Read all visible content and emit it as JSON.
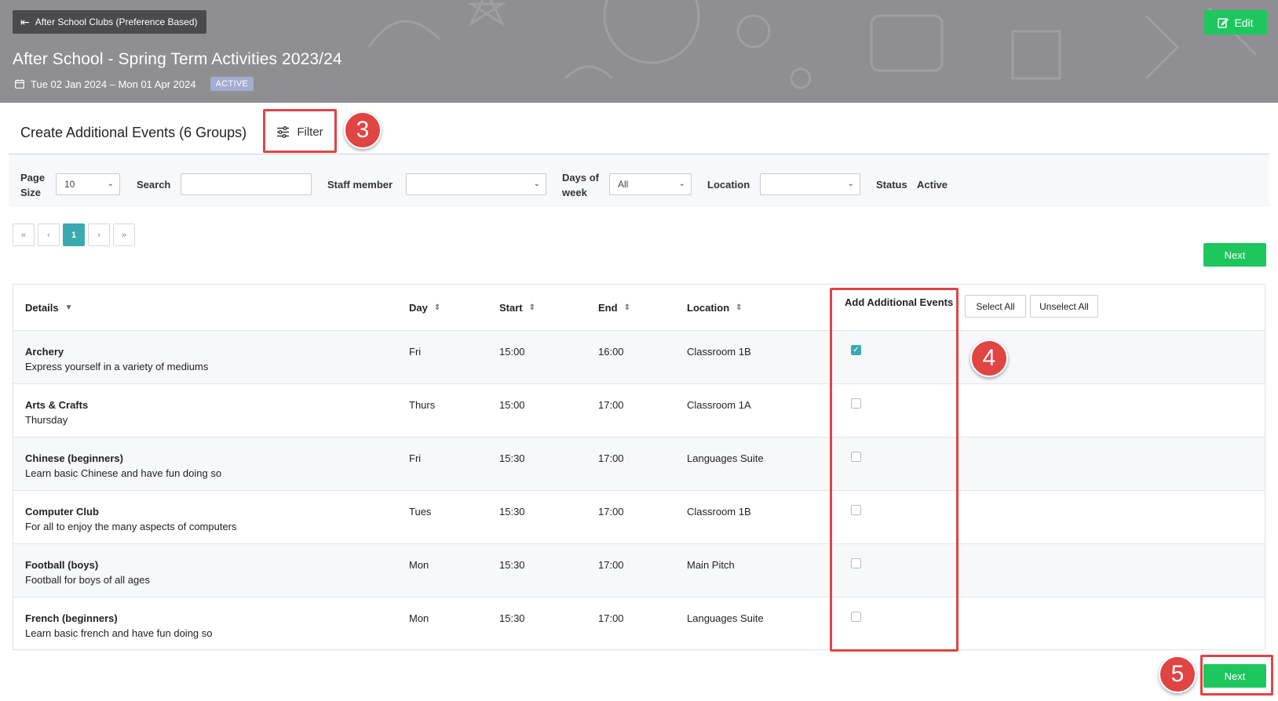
{
  "header": {
    "back_label": "After School Clubs (Preference Based)",
    "edit_label": "Edit",
    "title": "After School - Spring Term Activities 2023/24",
    "date_range": "Tue 02 Jan 2024 – Mon 01 Apr 2024",
    "status": "ACTIVE"
  },
  "section": {
    "title": "Create Additional Events (6 Groups)",
    "filter_label": "Filter"
  },
  "filters": {
    "page_size_label_1": "Page",
    "page_size_label_2": "Size",
    "page_size_value": "10",
    "search_label": "Search",
    "search_value": "",
    "staff_label": "Staff member",
    "staff_value": "",
    "days_label_1": "Days of",
    "days_label_2": "week",
    "days_value": "All",
    "location_label": "Location",
    "location_value": "",
    "status_label": "Status",
    "status_value": "Active"
  },
  "pagination": {
    "first": "«",
    "prev": "‹",
    "current": "1",
    "next": "›",
    "last": "»"
  },
  "next_label": "Next",
  "table": {
    "columns": {
      "details": "Details",
      "day": "Day",
      "start": "Start",
      "end": "End",
      "location": "Location",
      "add_events": "Add Additional Events"
    },
    "select_all": "Select All",
    "unselect_all": "Unselect All",
    "rows": [
      {
        "name": "Archery",
        "desc": "Express yourself in a variety of mediums",
        "day": "Fri",
        "start": "15:00",
        "end": "16:00",
        "location": "Classroom 1B",
        "checked": true
      },
      {
        "name": "Arts & Crafts",
        "desc": "Thursday",
        "day": "Thurs",
        "start": "15:00",
        "end": "17:00",
        "location": "Classroom 1A",
        "checked": false
      },
      {
        "name": "Chinese (beginners)",
        "desc": "Learn basic Chinese and have fun doing so",
        "day": "Fri",
        "start": "15:30",
        "end": "17:00",
        "location": "Languages Suite",
        "checked": false
      },
      {
        "name": "Computer Club",
        "desc": "For all to enjoy the many aspects of computers",
        "day": "Tues",
        "start": "15:30",
        "end": "17:00",
        "location": "Classroom 1B",
        "checked": false
      },
      {
        "name": "Football (boys)",
        "desc": "Football for boys of all ages",
        "day": "Mon",
        "start": "15:30",
        "end": "17:00",
        "location": "Main Pitch",
        "checked": false
      },
      {
        "name": "French (beginners)",
        "desc": "Learn basic french and have fun doing so",
        "day": "Mon",
        "start": "15:30",
        "end": "17:00",
        "location": "Languages Suite",
        "checked": false
      }
    ]
  },
  "annotations": {
    "step_filter": "3",
    "step_checkboxes": "4",
    "step_next": "5",
    "highlight_color": "#e04443"
  },
  "colors": {
    "accent_green": "#1ec65e",
    "accent_teal": "#3aa9b0",
    "banner_gray": "#8f8f92"
  },
  "icons": {
    "back": "arrow-bar-left-icon",
    "edit": "pencil-square-icon",
    "calendar": "calendar-icon",
    "filter": "sliders-icon",
    "sort": "sort-icon",
    "sort_desc": "caret-down-icon",
    "checkbox": "checkbox-icon",
    "chevron": "chevron-down-icon"
  }
}
